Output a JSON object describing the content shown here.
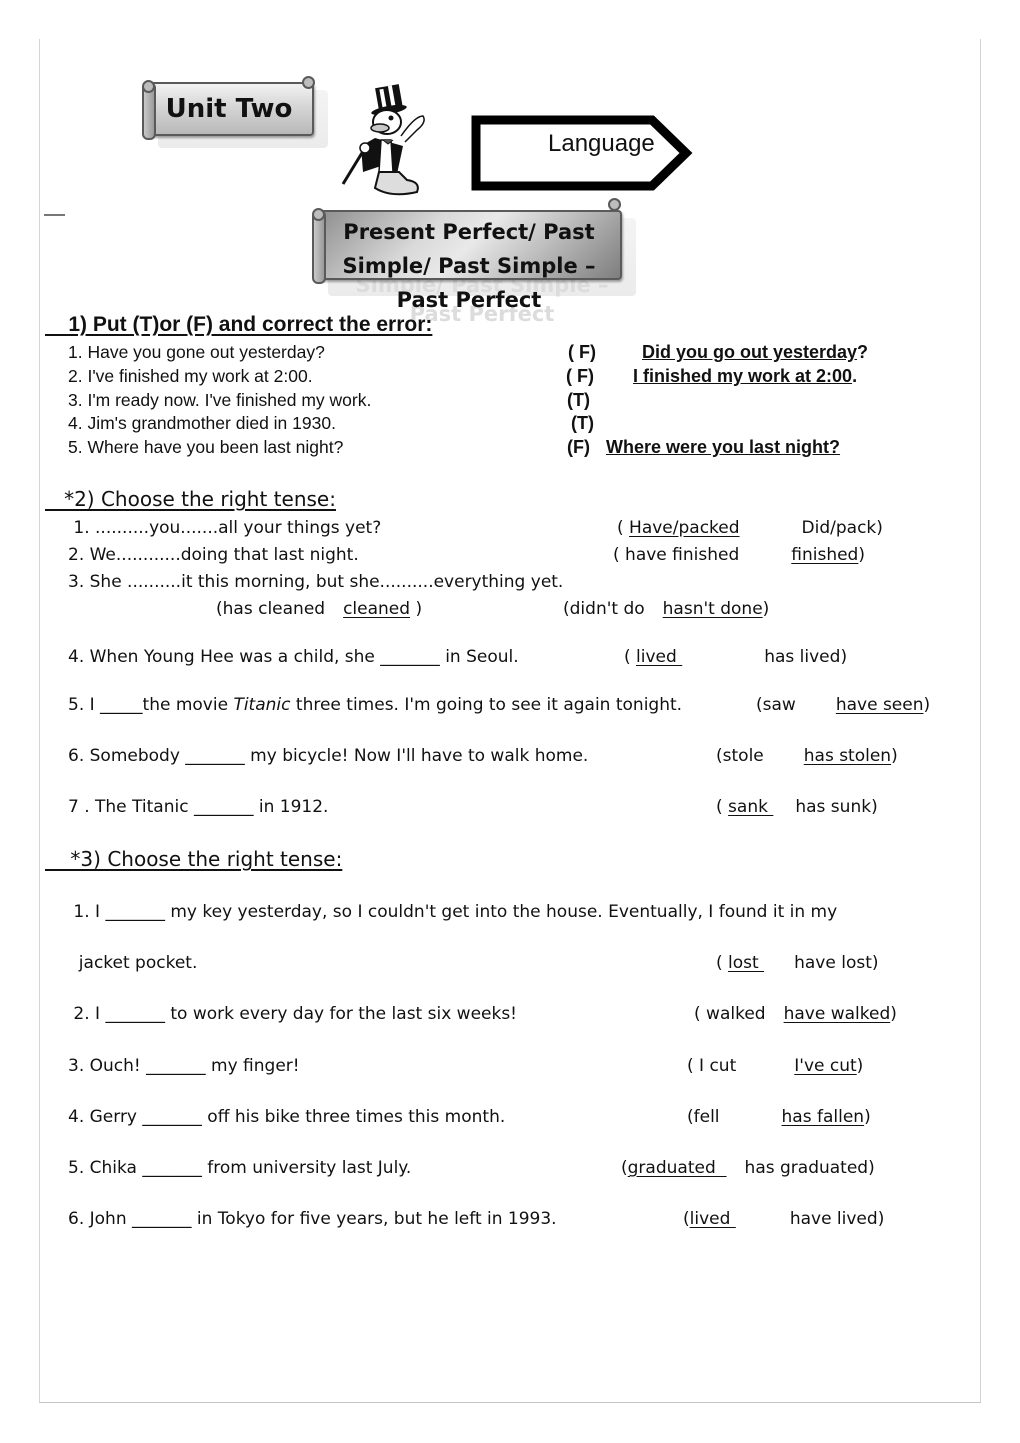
{
  "header": {
    "unit_banner": "Unit Two",
    "language_sign": "Language",
    "topic_banner_line1": "Present Perfect/ Past",
    "topic_banner_line2": "Simple/ Past Simple –",
    "topic_banner_line3": "Past Perfect",
    "mascot": "cartoon-duck-with-top-hat-and-cane"
  },
  "section1": {
    "heading": "    1) Put (T)or (F) and correct the error:",
    "items": [
      {
        "text": "1. Have you gone out yesterday?",
        "mark": "( F)",
        "correction": "Did you go out yesterday",
        "tail": "?"
      },
      {
        "text": "2. I've finished my work at 2:00.",
        "mark": "( F)",
        "correction": "I finished my work at 2:00",
        "tail": "."
      },
      {
        "text": "3. I'm ready now. I've finished my work.",
        "mark": "(T)",
        "correction": "",
        "tail": ""
      },
      {
        "text": "4. Jim's grandmother died in 1930.",
        "mark": "(T)",
        "correction": "",
        "tail": ""
      },
      {
        "text": "5. Where have you been last night?",
        "mark": "(F)",
        "correction": "Where were you last night?",
        "tail": ""
      }
    ]
  },
  "section2": {
    "heading": "   *2) Choose the right tense:",
    "items": [
      {
        "text": " 1. ..........you.......all your things yet?",
        "open": "( ",
        "opt1": "Have/packed",
        "opt2": "Did/pack",
        "close": ")",
        "answer": 1
      },
      {
        "text": "2. We............doing that last night.",
        "open": "( ",
        "opt1": "have finished",
        "opt2": "finished",
        "close": ")",
        "answer": 2
      },
      {
        "text": "3. She ..........it this morning, but she..........everything yet.",
        "open": "",
        "opt1": "",
        "opt2": "",
        "close": "",
        "answer": 0
      },
      {
        "text": "",
        "open": "(",
        "opt1": "has cleaned",
        "opt2": "cleaned",
        "close": " )",
        "answer": 2,
        "open_b": "(",
        "opt1_b": "didn't do",
        "opt2_b": "hasn't done",
        "close_b": ")",
        "answer_b": 2
      },
      {
        "text": "4. When Young Hee was a child, she _______ in Seoul.",
        "open": "( ",
        "opt1": "lived ",
        "opt2": "has lived",
        "close": ")",
        "answer": 1
      },
      {
        "text_before": "5. I _____the movie ",
        "text_italic": "Titanic",
        "text_after": " three times. I'm going to see it again tonight.",
        "open": "(",
        "opt1": "saw",
        "opt2": "have seen",
        "close": ")",
        "answer": 2
      },
      {
        "text": "6. Somebody _______ my bicycle! Now I'll have to walk home.",
        "open": "(",
        "opt1": "stole",
        "opt2": "has stolen",
        "close": ")",
        "answer": 2
      },
      {
        "text": "7 . The Titanic _______ in 1912.",
        "open": "( ",
        "opt1": "sank ",
        "opt2": "has sunk",
        "close": ")",
        "answer": 1
      }
    ]
  },
  "section3": {
    "heading": "    *3) Choose the right tense:",
    "items": [
      {
        "text": " 1. I _______ my key yesterday, so I couldn't get into the house. Eventually, I found it in my",
        "text2": "  jacket pocket.",
        "open": "( ",
        "opt1": "lost ",
        "opt2": "have lost",
        "close": ")",
        "answer": 1
      },
      {
        "text": " 2. I _______ to work every day for the last six weeks!",
        "open": "( ",
        "opt1": "walked",
        "opt2": "have walked",
        "close": ")",
        "answer": 2
      },
      {
        "text": "3. Ouch! _______ my finger!",
        "open": "( ",
        "opt1": "I cut",
        "opt2": "I've cut",
        "close": ")",
        "answer": 2
      },
      {
        "text": "4. Gerry _______ off his bike three times this month.",
        "open": "(",
        "opt1": "fell",
        "opt2": "has fallen",
        "close": ")",
        "answer": 2
      },
      {
        "text": "5. Chika _______ from university last July.",
        "open": "(",
        "opt1": "graduated  ",
        "opt2": "has graduated",
        "close": ")",
        "answer": 1
      },
      {
        "text": "6. John _______ in Tokyo for five years, but he left in 1993.",
        "open": "(",
        "opt1": "lived ",
        "opt2": "have lived",
        "close": ")",
        "answer": 1
      }
    ]
  }
}
